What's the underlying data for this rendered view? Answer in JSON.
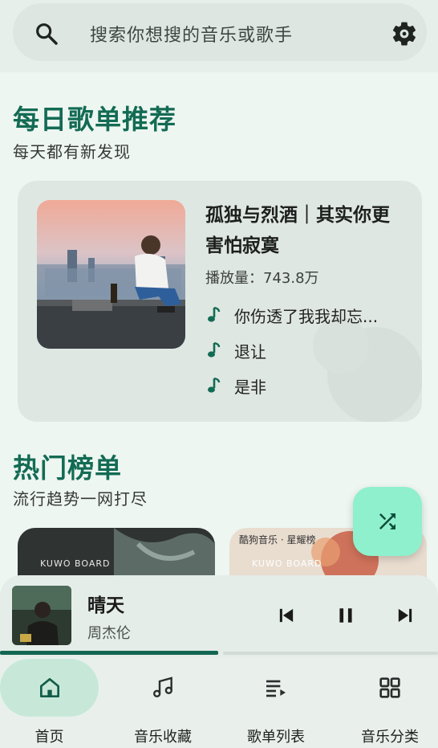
{
  "search": {
    "placeholder": "搜索你想搜的音乐或歌手"
  },
  "daily": {
    "title": "每日歌单推荐",
    "subtitle": "每天都有新发现",
    "playlist": {
      "title": "孤独与烈酒｜其实你更害怕寂寞",
      "plays": "播放量：743.8万",
      "songs": [
        "你伤透了我我却忘...",
        "退让",
        "是非"
      ]
    }
  },
  "charts": {
    "title": "热门榜单",
    "subtitle": "流行趋势一网打尽",
    "card_badges": [
      "KUWO BOARD",
      "KUWO BOARD"
    ],
    "card_top_text": "酷狗音乐 · 星耀榜"
  },
  "now_playing": {
    "title": "晴天",
    "artist": "周杰伦",
    "progress": 0.5
  },
  "nav": {
    "items": [
      "首页",
      "音乐收藏",
      "歌单列表",
      "音乐分类"
    ],
    "active": 0
  },
  "colors": {
    "accent": "#136b54",
    "fab": "#8ff0cd",
    "active_pill": "#c7e8d9"
  }
}
